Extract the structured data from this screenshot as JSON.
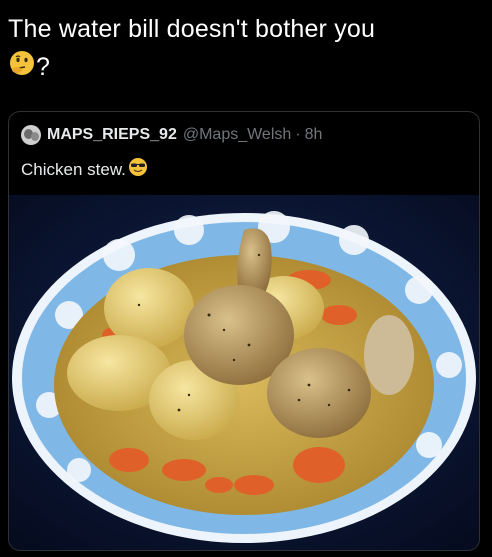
{
  "caption": {
    "text": "The water bill doesn't bother you",
    "question_mark": "?",
    "emoji": "thinking-face-emoji"
  },
  "tweet": {
    "display_name": "MAPS_RIEPS_92",
    "handle": "@Maps_Welsh",
    "separator": "·",
    "time": "8h",
    "text": "Chicken stew.",
    "emoji": "sunglasses-face-emoji"
  },
  "image": {
    "subject": "bowl-of-chicken-stew",
    "colors": {
      "background": "#0d1a3a",
      "bowl_rim": "#6fb2e8",
      "broth": "#c9a94a",
      "carrot": "#e0602a",
      "potato": "#e8d27a",
      "chicken": "#b89a68"
    }
  }
}
